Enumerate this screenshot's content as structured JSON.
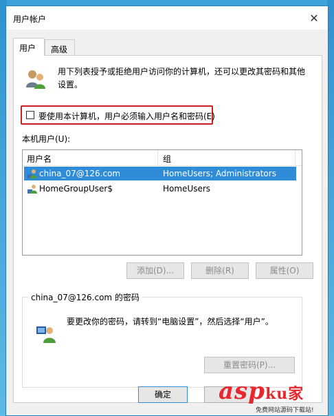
{
  "window": {
    "title": "用户帐户",
    "close_glyph": "✕"
  },
  "tabs": [
    {
      "label": "用户"
    },
    {
      "label": "高级"
    }
  ],
  "intro_text": "用下列表授予或拒绝用户访问你的计算机，还可以更改其密码和其他设置。",
  "require_password": {
    "label": "要使用本计算机，用户必须输入用户名和密码(E)",
    "checked": false
  },
  "local_users": {
    "label": "本机用户(U):",
    "columns": [
      "用户名",
      "组"
    ],
    "rows": [
      {
        "name": "china_07@126.com",
        "group": "HomeUsers; Administrators",
        "selected": true
      },
      {
        "name": "HomeGroupUser$",
        "group": "HomeUsers",
        "selected": false
      }
    ]
  },
  "buttons": {
    "add": "添加(D)...",
    "remove": "删除(R)",
    "properties": "属性(O)"
  },
  "password_group": {
    "title": "china_07@126.com 的密码",
    "text": "要更改你的密码，请转到“电脑设置”，然后选择“用户”。",
    "reset_button": "重置密码(P)..."
  },
  "dialog": {
    "ok": "确定"
  },
  "watermark": {
    "main": "asp",
    "cn": "ku家",
    "sub": "免费网站源码下载站!"
  },
  "colors": {
    "selection": "#2f8cd8",
    "highlight_border": "#c8241e",
    "watermark": "#e8262c"
  }
}
